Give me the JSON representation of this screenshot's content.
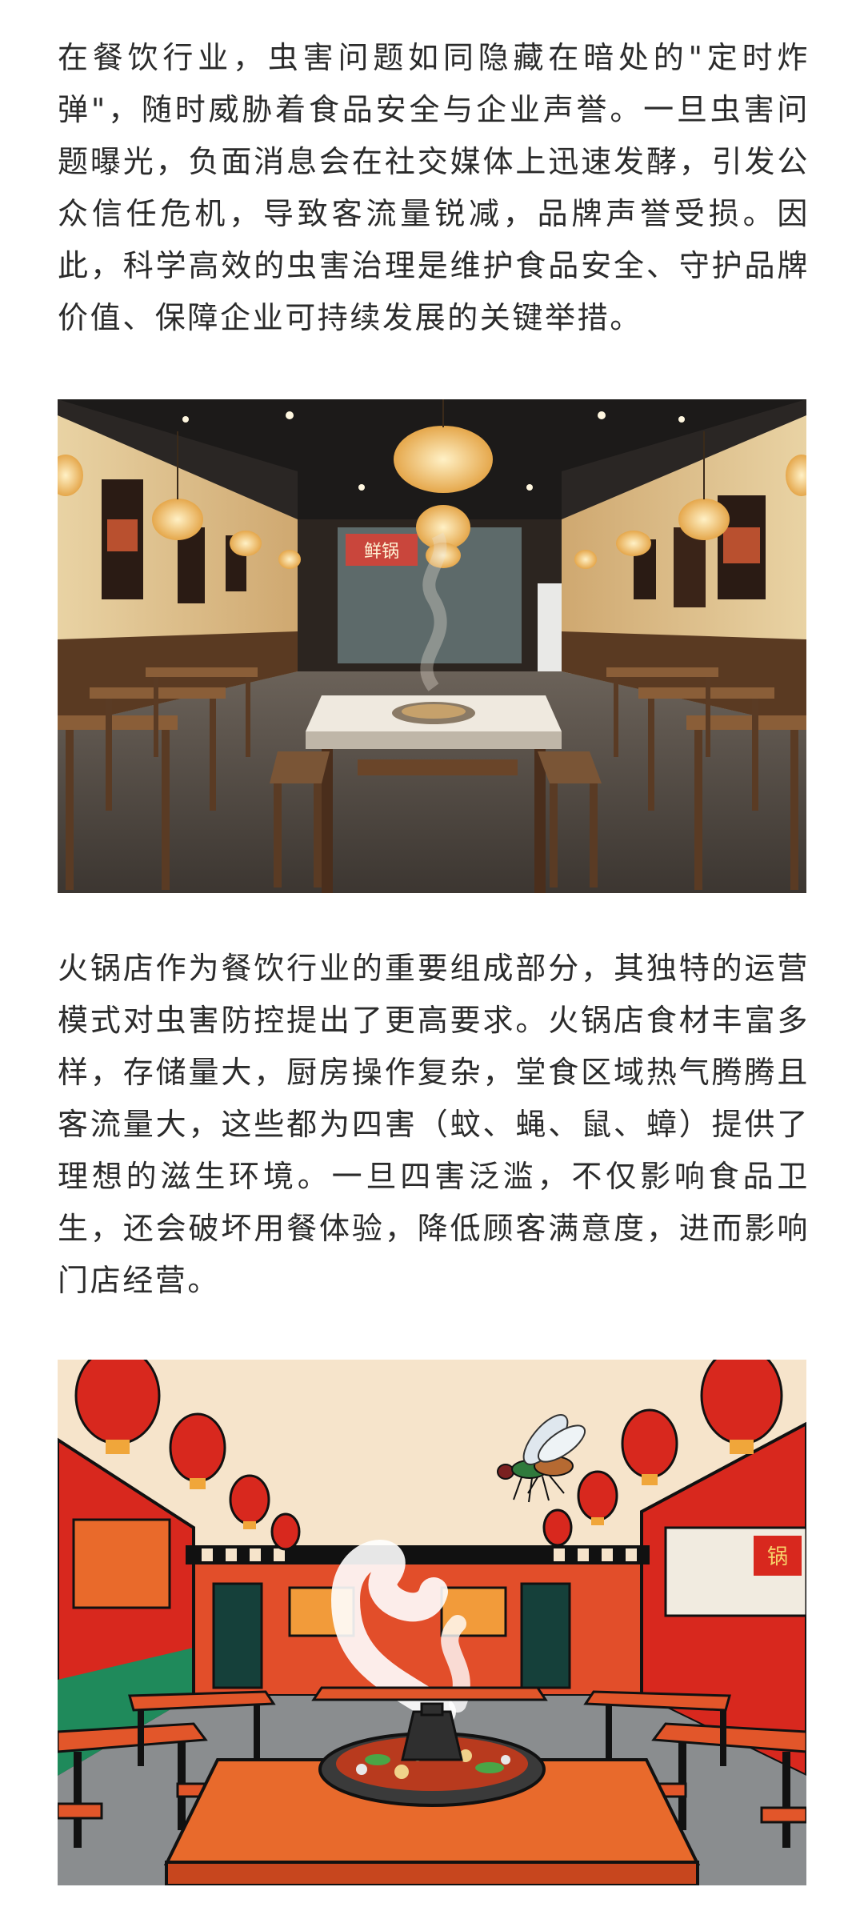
{
  "article": {
    "paragraph_1": "在餐饮行业，虫害问题如同隐藏在暗处的\"定时炸弹\"，随时威胁着食品安全与企业声誉。一旦虫害问题曝光，负面消息会在社交媒体上迅速发酵，引发公众信任危机，导致客流量锐减，品牌声誉受损。因此，科学高效的虫害治理是维护食品安全、守护品牌价值、保障企业可持续发展的关键举措。",
    "paragraph_2": "火锅店作为餐饮行业的重要组成部分，其独特的运营模式对虫害防控提出了更高要求。火锅店食材丰富多样，存储量大，厨房操作复杂，堂食区域热气腾腾且客流量大，这些都为四害（蚊、蝇、鼠、蟑）提供了理想的滋生环境。一旦四害泛滥，不仅影响食品卫生，还会破坏用餐体验，降低顾客满意度，进而影响门店经营。"
  },
  "images": {
    "photo_1": {
      "icon": "restaurant-photo",
      "sign_text": "鲜锅"
    },
    "photo_2": {
      "icon": "hotpot-fly-illustration",
      "sign_text": "锅"
    }
  },
  "colors": {
    "text": "#2b2b2b",
    "background": "#ffffff",
    "lantern_red": "#d8281e",
    "wall_cream": "#f3e7cf"
  }
}
